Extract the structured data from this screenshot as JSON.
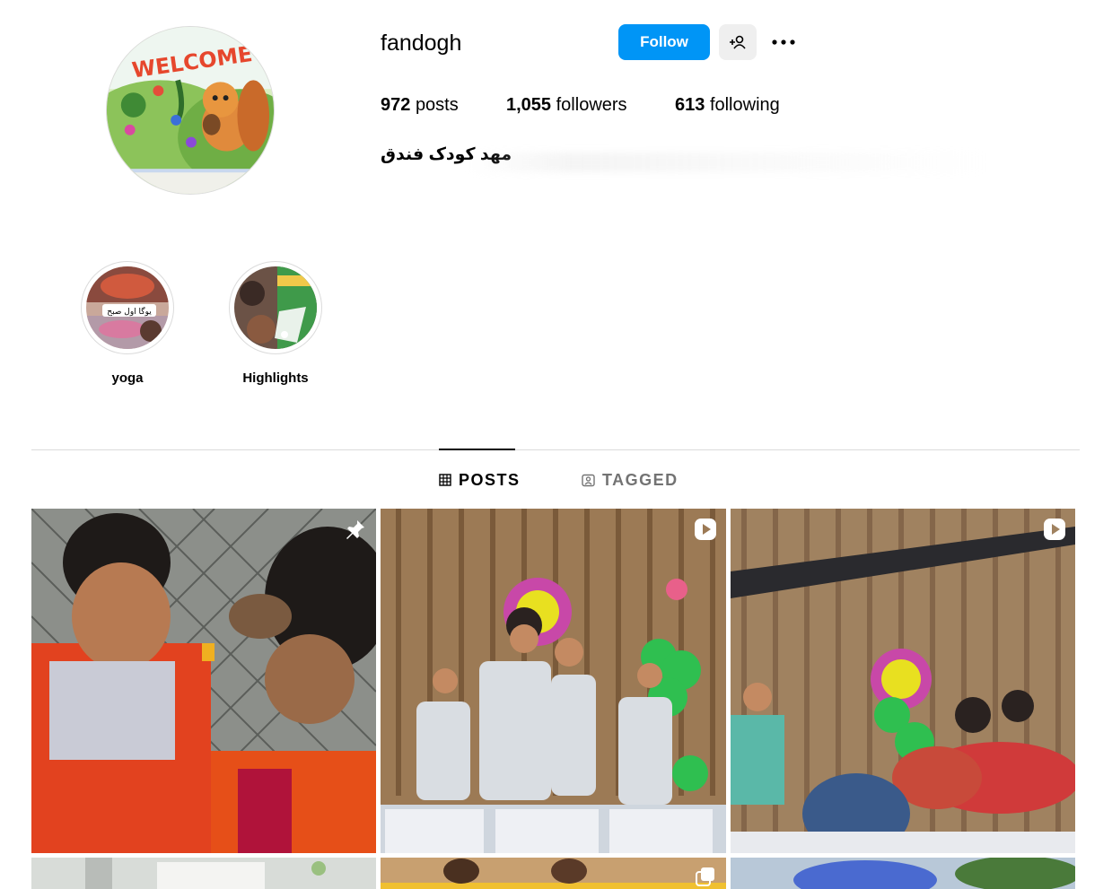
{
  "profile": {
    "username": "fandogh",
    "follow_label": "Follow",
    "stats": {
      "posts_count": "972",
      "posts_label": "posts",
      "followers_count": "1,055",
      "followers_label": "followers",
      "following_count": "613",
      "following_label": "following"
    },
    "bio_name": "مهد کودک فندق",
    "avatar_text": "WELCOME"
  },
  "highlights": [
    {
      "label": "yoga",
      "overlay_text": "یوگا اول صبح"
    },
    {
      "label": "Highlights"
    }
  ],
  "tabs": [
    {
      "label": "POSTS",
      "icon": "grid-icon",
      "active": true
    },
    {
      "label": "TAGGED",
      "icon": "tagged-icon",
      "active": false
    }
  ],
  "posts": [
    {
      "badge": "pin-icon"
    },
    {
      "badge": "reel-icon"
    },
    {
      "badge": "reel-icon"
    },
    {
      "badge": ""
    },
    {
      "badge": "carousel-icon"
    },
    {
      "badge": ""
    }
  ],
  "colors": {
    "accent": "#0095f6",
    "secondary_button": "#efefef",
    "divider": "#dbdbdb",
    "muted_text": "#737373"
  }
}
